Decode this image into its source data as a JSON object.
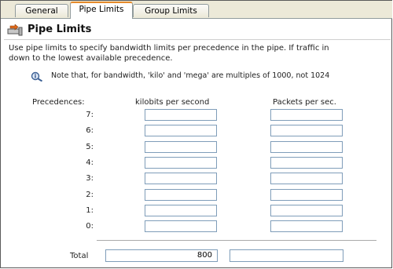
{
  "tabs": {
    "general": "General",
    "pipe_limits": "Pipe Limits",
    "group_limits": "Group Limits"
  },
  "panel": {
    "title": "Pipe Limits",
    "title_icon": "pipe-icon",
    "description_line1": "Use pipe limits to specify bandwidth limits per precedence in the pipe. If traffic in",
    "description_line2": "down to the lowest available precedence.",
    "note_icon": "info-magnifier-icon",
    "note": "Note that, for bandwidth, 'kilo' and 'mega' are multiples of 1000, not 1024"
  },
  "columns": {
    "precedences": "Precedences:",
    "kbps": "kilobits per second",
    "pps": "Packets per sec."
  },
  "rows": [
    {
      "label": "7:",
      "kbps": "",
      "pps": ""
    },
    {
      "label": "6:",
      "kbps": "",
      "pps": ""
    },
    {
      "label": "5:",
      "kbps": "",
      "pps": ""
    },
    {
      "label": "4:",
      "kbps": "",
      "pps": ""
    },
    {
      "label": "3:",
      "kbps": "",
      "pps": ""
    },
    {
      "label": "2:",
      "kbps": "",
      "pps": ""
    },
    {
      "label": "1:",
      "kbps": "",
      "pps": ""
    },
    {
      "label": "0:",
      "kbps": "",
      "pps": ""
    }
  ],
  "total": {
    "label": "Total",
    "kbps": "800",
    "pps": ""
  },
  "colors": {
    "active_tab_accent": "#e68b2c",
    "field_border": "#7f9db9",
    "tabbar_bg": "#ece9d8"
  }
}
